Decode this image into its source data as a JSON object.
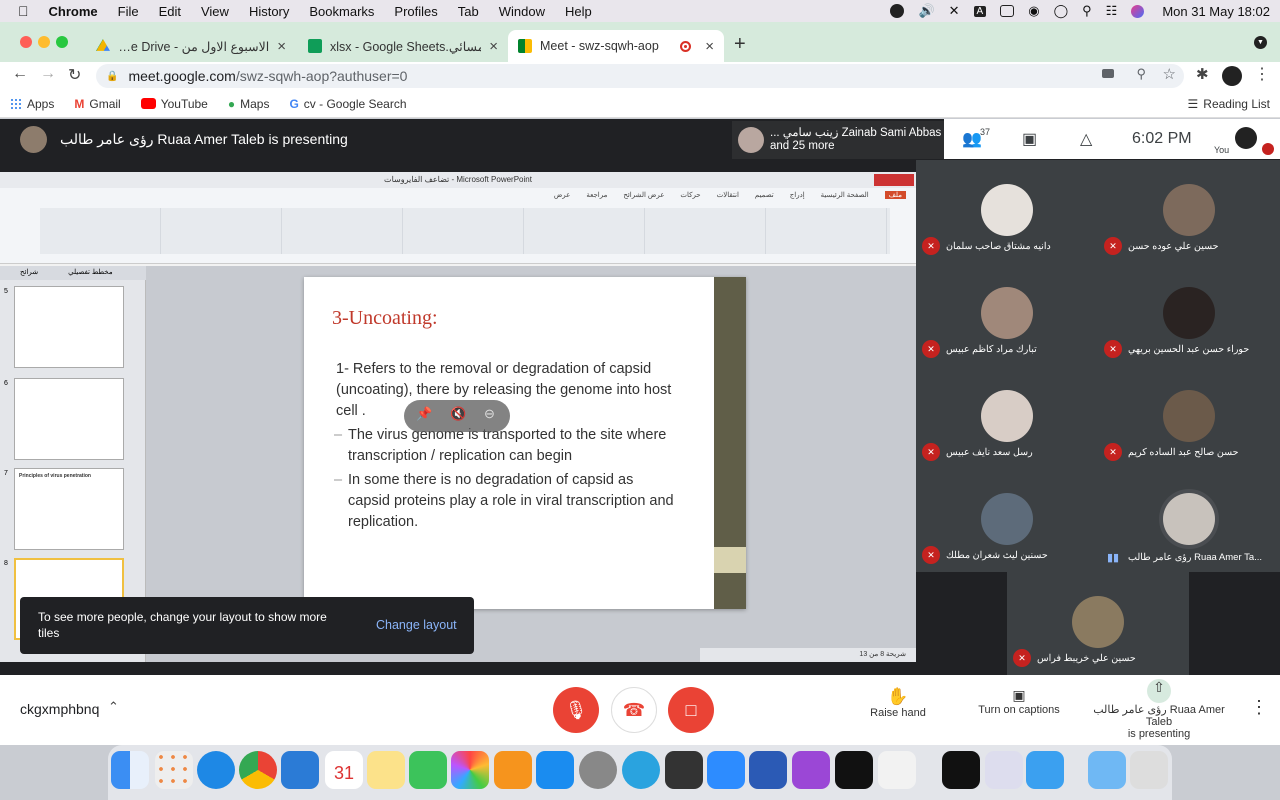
{
  "menubar": {
    "app": "Chrome",
    "items": [
      "File",
      "Edit",
      "View",
      "History",
      "Bookmarks",
      "Profiles",
      "Tab",
      "Window",
      "Help"
    ],
    "datetime": "Mon 31 May  18:02"
  },
  "tabs": [
    {
      "label": "الاسبوع الاول من - Google Drive",
      "favicon": "google-drive-icon",
      "color": "#1fa463"
    },
    {
      "label": "xlsx - Google Sheets.المسائي",
      "favicon": "google-sheets-icon",
      "color": "#0f9d58"
    },
    {
      "label": "Meet - swz-sqwh-aop",
      "favicon": "google-meet-icon",
      "color": "#00832d",
      "active": true
    }
  ],
  "address": {
    "host": "meet.google.com",
    "path": "/swz-sqwh-aop?authuser=0"
  },
  "bookmarks": [
    {
      "label": "Apps",
      "icon": "apps-grid-icon"
    },
    {
      "label": "Gmail",
      "icon": "gmail-icon"
    },
    {
      "label": "YouTube",
      "icon": "youtube-icon"
    },
    {
      "label": "Maps",
      "icon": "maps-pin-icon"
    },
    {
      "label": "cv - Google Search",
      "icon": "google-icon"
    }
  ],
  "reading_list": "Reading List",
  "meet": {
    "presenter_banner": "رؤى عامر طالب Ruaa Amer Taleb is presenting",
    "top_participant": "... زينب سامي Zainab Sami Abbas",
    "top_participant_more": "and 25 more",
    "people_count": "37",
    "time": "6:02  PM",
    "you_label": "You",
    "tiles": [
      {
        "name": "دانيه مشتاق صاحب سلمان",
        "muted": true
      },
      {
        "name": "حسين علي عوده حسن",
        "muted": true
      },
      {
        "name": "تبارك مراد كاظم عبيس",
        "muted": true
      },
      {
        "name": "حوراء حسن عبد الحسين بريهي",
        "muted": true
      },
      {
        "name": "رسل سعد نايف عبيس",
        "muted": true
      },
      {
        "name": "حسن صالح عبد الساده كريم",
        "muted": true
      },
      {
        "name": "حسنين ليث شعران مطلك",
        "muted": true
      },
      {
        "name": "رؤى عامر طالب Ruaa Amer Ta...",
        "muted": false
      },
      {
        "name": "حسين علي خريبط فراس",
        "muted": true
      }
    ],
    "snackbar": {
      "text": "To see more people, change your layout to show more tiles",
      "action": "Change layout"
    },
    "meeting_code": "ckgxmphbnq",
    "raise_hand": "Raise hand",
    "captions": "Turn on captions",
    "presenting_line1": "رؤى عامر طالب Ruaa Amer Taleb",
    "presenting_line2": "is presenting"
  },
  "ppt": {
    "window_title": "تضاعف الفايروسات - Microsoft PowerPoint",
    "ribbon_tabs": [
      "ملف",
      "الصفحة الرئيسية",
      "إدراج",
      "تصميم",
      "انتقالات",
      "حركات",
      "عرض الشرائح",
      "مراجعة",
      "عرض"
    ],
    "pane_tabs": [
      "شرائح",
      "مخطط تفصيلي"
    ],
    "thumb_numbers": [
      "5",
      "6",
      "7",
      "8"
    ],
    "thumb_title_7": "Principles of virus penetration",
    "slide": {
      "title": "3-Uncoating:",
      "point1": "1- Refers to the removal or degradation of capsid (uncoating), there by releasing the genome into host cell .",
      "point2": "The virus genome is transported to the site where transcription / replication can begin",
      "point3": "In some there is no degradation of capsid as capsid proteins play a role in viral transcription and replication."
    },
    "status": "شريحة 8 من 13"
  },
  "colors": {
    "meet_bg": "#202124",
    "end_red": "#ea4335",
    "mute_red": "#c5221f",
    "accent_green": "#8ab4f8"
  }
}
